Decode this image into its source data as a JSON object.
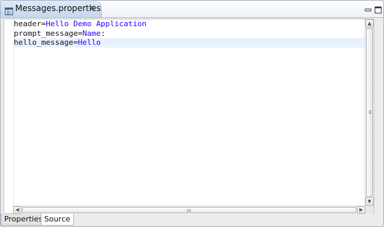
{
  "tab": {
    "title": "Messages.properties",
    "close_glyph": "✕"
  },
  "window_controls": {
    "minimize_icon": "minimize-icon",
    "maximize_icon": "maximize-icon"
  },
  "editor": {
    "lines": [
      {
        "key": "header",
        "sep": "=",
        "value": "Hello Demo Application"
      },
      {
        "key": "prompt_message",
        "sep": "=",
        "value": "Name",
        "suffix": ":"
      },
      {
        "key": "hello_message",
        "sep": "=",
        "value": "Hello"
      }
    ],
    "current_line": 2
  },
  "page_tabs": [
    {
      "label": "Properties"
    },
    {
      "label": "Source",
      "active": true
    }
  ],
  "colors": {
    "value": "#2a00ff",
    "current_line": "#e8f2fe"
  }
}
